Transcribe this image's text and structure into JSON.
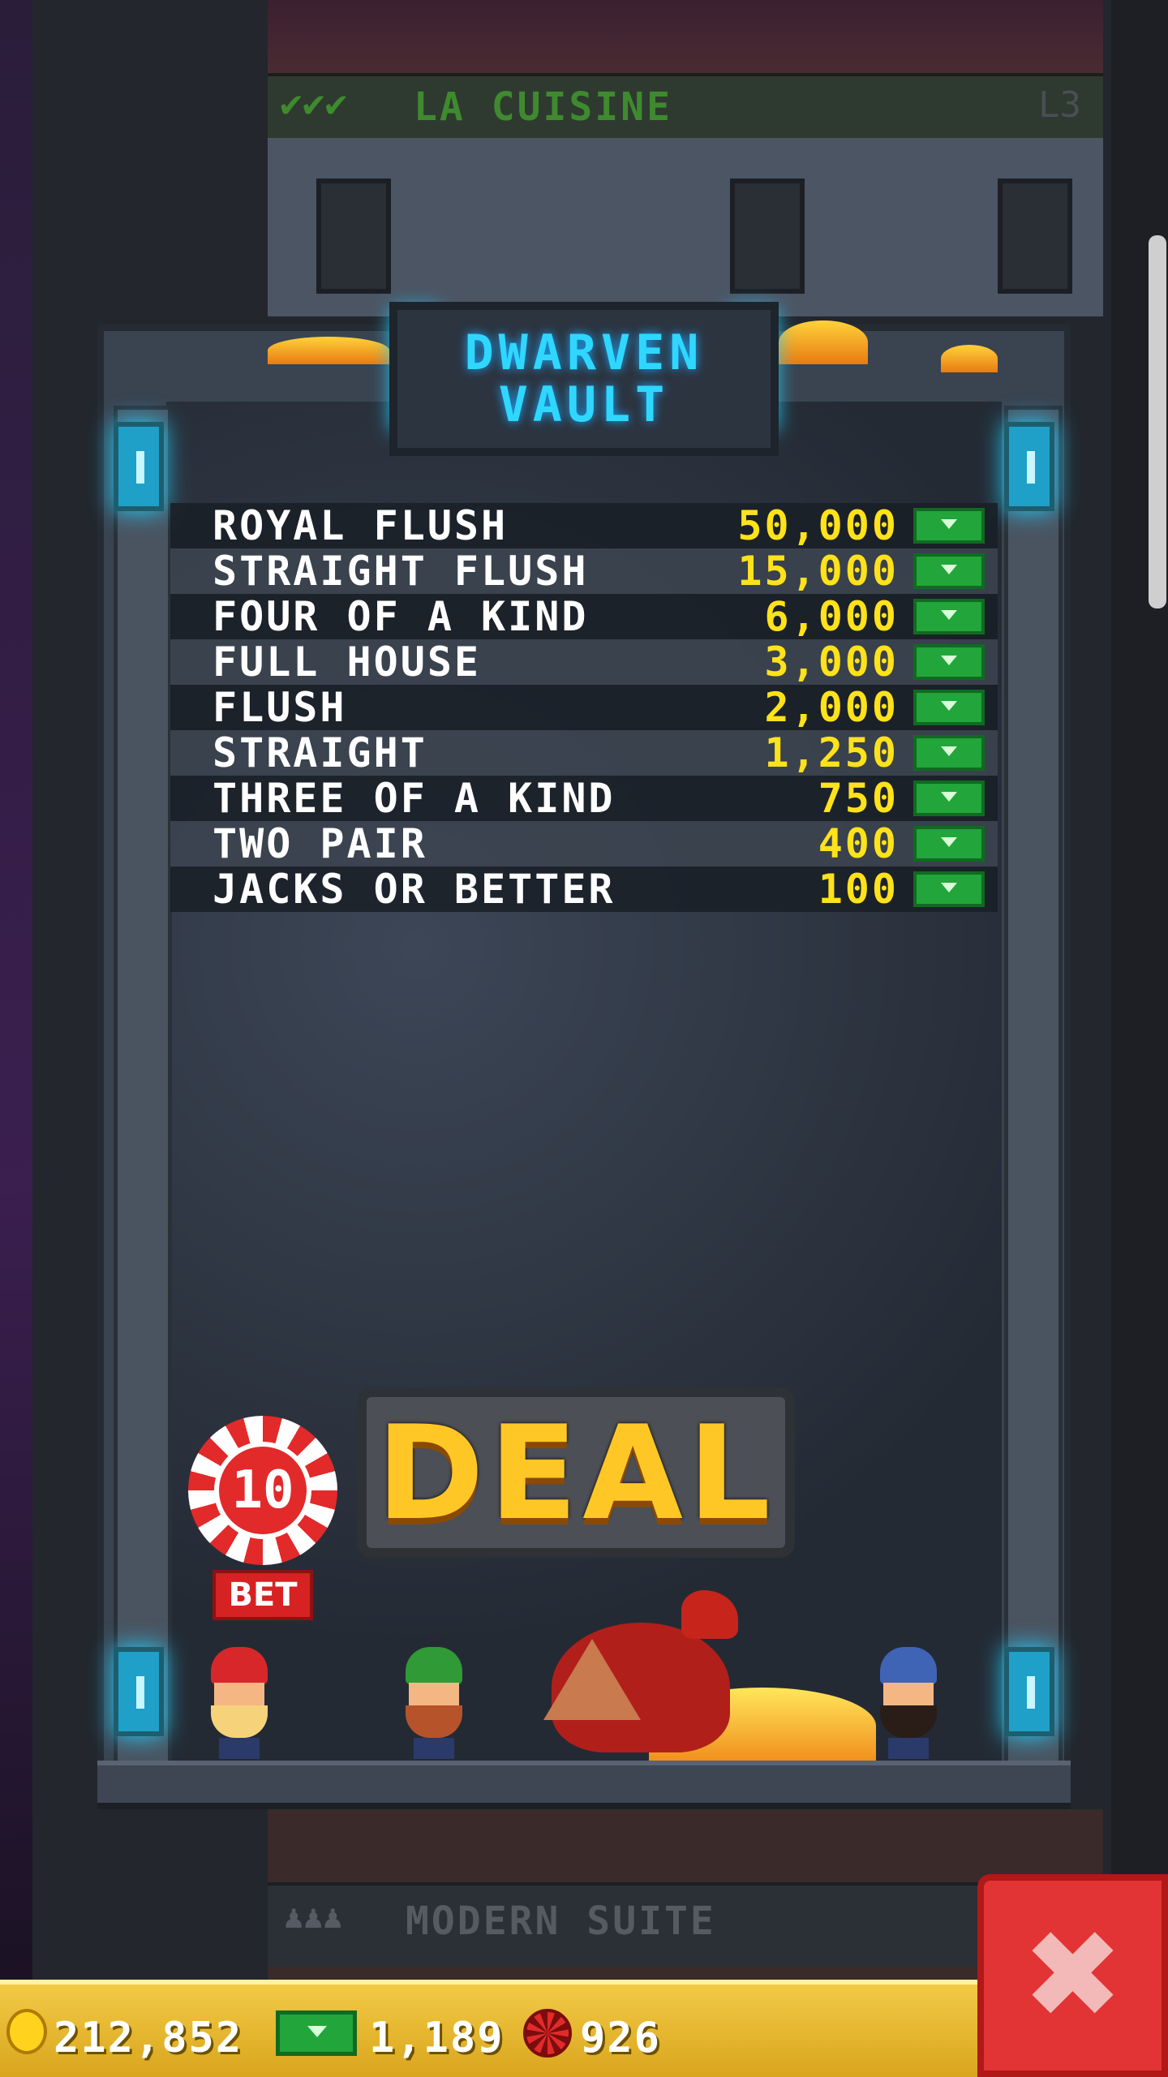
{
  "top_floor": {
    "name": "LA CUISINE",
    "level": "L3",
    "checks": "✔✔✔"
  },
  "bottom_floor": {
    "name": "MODERN SUITE",
    "people": "♟♟♟"
  },
  "vault": {
    "title_line1": "DWARVEN",
    "title_line2": "VAULT",
    "paytable": [
      {
        "hand": "ROYAL FLUSH",
        "payout": "50,000"
      },
      {
        "hand": "STRAIGHT FLUSH",
        "payout": "15,000"
      },
      {
        "hand": "FOUR OF A KIND",
        "payout": "6,000"
      },
      {
        "hand": "FULL HOUSE",
        "payout": "3,000"
      },
      {
        "hand": "FLUSH",
        "payout": "2,000"
      },
      {
        "hand": "STRAIGHT",
        "payout": "1,250"
      },
      {
        "hand": "THREE OF A KIND",
        "payout": "750"
      },
      {
        "hand": "TWO PAIR",
        "payout": "400"
      },
      {
        "hand": "JACKS OR BETTER",
        "payout": "100"
      }
    ],
    "deal_label": "DEAL",
    "bet_value": "10",
    "bet_label": "BET"
  },
  "status_bar": {
    "coins": "212,852",
    "bux": "1,189",
    "chips": "926"
  },
  "close_label": "✖",
  "colors": {
    "accent_cyan": "#2fd7ff",
    "payout_yellow": "#ffe21a",
    "cash_green": "#22a53a",
    "close_red": "#e23434"
  }
}
